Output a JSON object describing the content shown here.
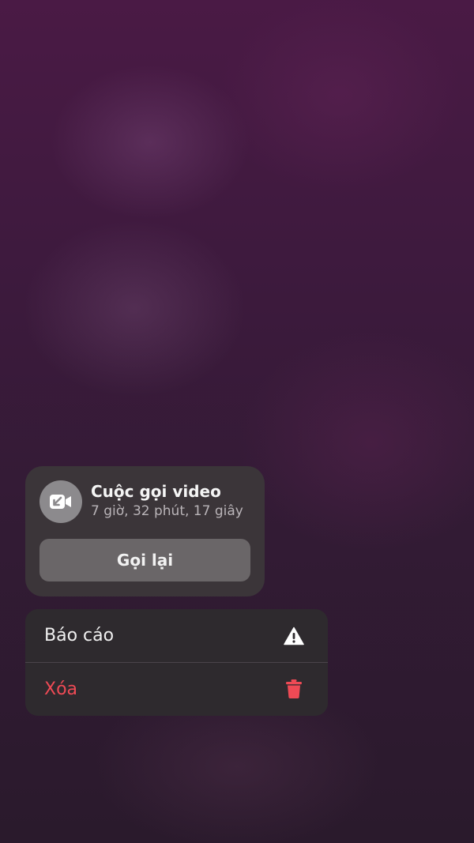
{
  "call_card": {
    "icon": "video-call-incoming-icon",
    "title": "Cuộc gọi video",
    "duration": "7 giờ, 32 phút, 17 giây",
    "callback_label": "Gọi lại"
  },
  "menu": {
    "items": [
      {
        "label": "Báo cáo",
        "icon": "warning-icon",
        "color": "#f0f0f0"
      },
      {
        "label": "Xóa",
        "icon": "trash-icon",
        "color": "#ef4a55"
      }
    ]
  }
}
